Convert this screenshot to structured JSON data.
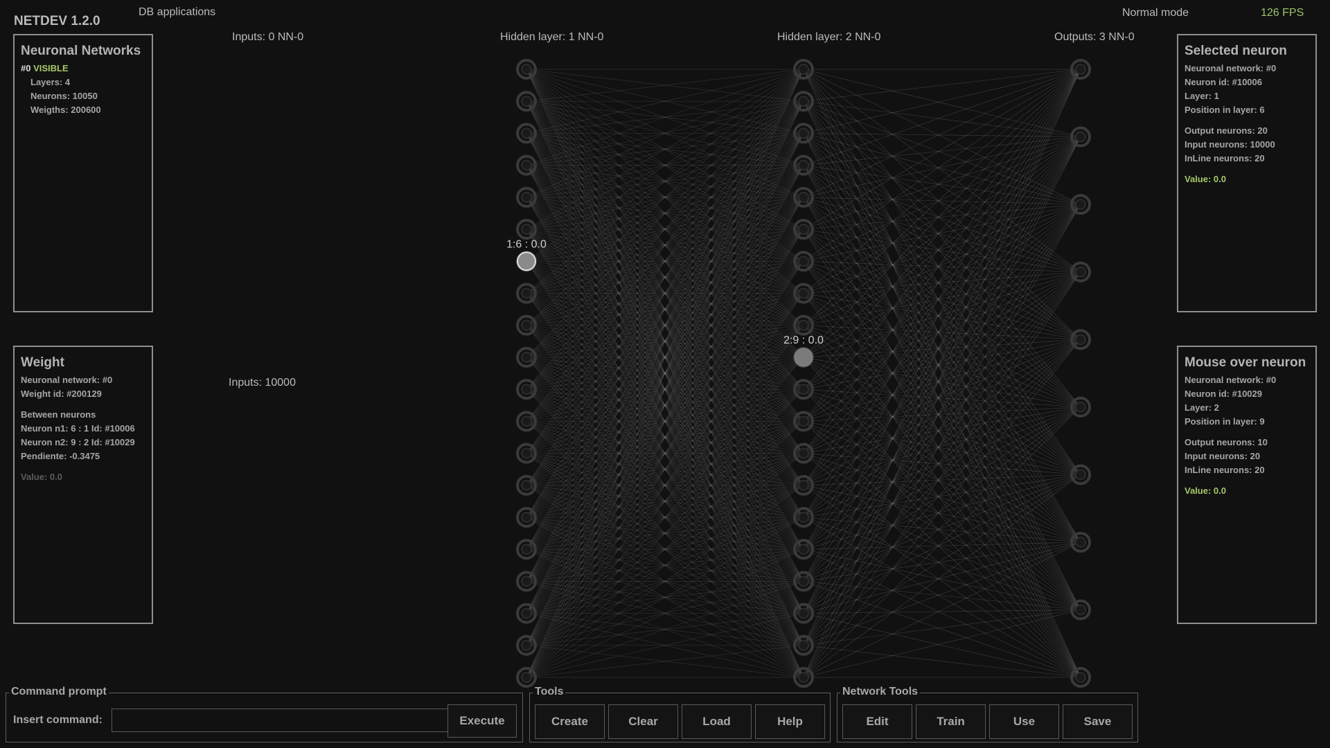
{
  "header": {
    "app_title": "NETDEV 1.2.0",
    "menu": "DB applications",
    "mode": "Normal mode",
    "fps": "126 FPS"
  },
  "layers": {
    "input_label": "Inputs: 0  NN-0",
    "hidden1_label": "Hidden layer: 1  NN-0",
    "hidden2_label": "Hidden layer: 2  NN-0",
    "output_label": "Outputs: 3  NN-0",
    "inputs_count": "Inputs: 10000"
  },
  "network": {
    "hidden1_neurons": 20,
    "hidden2_neurons": 20,
    "output_neurons": 10,
    "selected_neuron": {
      "layer": 1,
      "position": 6,
      "label": "1:6 : 0.0"
    },
    "hovered_neuron": {
      "layer": 2,
      "position": 9,
      "label": "2:9 : 0.0"
    }
  },
  "networks_panel": {
    "title": "Neuronal Networks",
    "id": "#0",
    "status": "VISIBLE",
    "layers": "Layers: 4",
    "neurons": "Neurons: 10050",
    "weights": "Weigths: 200600"
  },
  "weight_panel": {
    "title": "Weight",
    "network": "Neuronal network: #0",
    "weight_id": "Weight id: #200129",
    "between": "Between neurons",
    "n1": "Neuron n1: 6 : 1 Id: #10006",
    "n2": "Neuron n2: 9 : 2 Id: #10029",
    "slope": "Pendiente: -0.3475",
    "value": "Value: 0.0"
  },
  "selected_panel": {
    "title": "Selected neuron",
    "network": "Neuronal network: #0",
    "neuron_id": "Neuron id: #10006",
    "layer": "Layer: 1",
    "position": "Position in layer: 6",
    "output_neurons": "Output neurons: 20",
    "input_neurons": "Input neurons: 10000",
    "inline_neurons": "InLine neurons: 20",
    "value": "Value: 0.0"
  },
  "mouse_panel": {
    "title": "Mouse over neuron",
    "network": "Neuronal network: #0",
    "neuron_id": "Neuron id: #10029",
    "layer": "Layer: 2",
    "position": "Position in layer: 9",
    "output_neurons": "Output neurons: 10",
    "input_neurons": "Input neurons: 20",
    "inline_neurons": "InLine neurons: 20",
    "value": "Value: 0.0"
  },
  "command": {
    "group_title": "Command prompt",
    "label": "Insert command:",
    "value": "",
    "execute": "Execute"
  },
  "tools": {
    "group_title": "Tools",
    "create": "Create",
    "clear": "Clear",
    "load": "Load",
    "help": "Help"
  },
  "network_tools": {
    "group_title": "Network Tools",
    "edit": "Edit",
    "train": "Train",
    "use": "Use",
    "save": "Save"
  },
  "colors": {
    "background": "#111111",
    "accent_green": "#a6c86a",
    "panel_border": "#8f8f8f"
  }
}
